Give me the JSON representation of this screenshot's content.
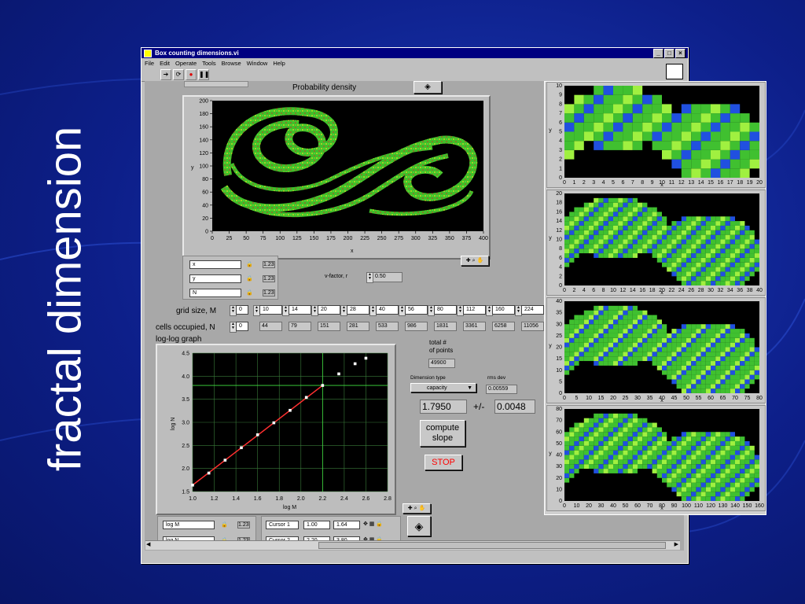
{
  "slide": {
    "title": "fractal dimension"
  },
  "window": {
    "title": "Box counting dimensions.vi",
    "controls": [
      "_",
      "□",
      "×"
    ]
  },
  "menu": [
    "File",
    "Edit",
    "Operate",
    "Tools",
    "Browse",
    "Window",
    "Help"
  ],
  "prob": {
    "label": "Probability density",
    "xlabel": "x",
    "ylabel": "y",
    "xticks": [
      "0",
      "25",
      "50",
      "75",
      "100",
      "125",
      "150",
      "175",
      "200",
      "225",
      "250",
      "275",
      "300",
      "325",
      "350",
      "375",
      "400"
    ],
    "yticks": [
      "0",
      "20",
      "40",
      "60",
      "80",
      "100",
      "120",
      "140",
      "160",
      "180",
      "200"
    ]
  },
  "legend1": [
    "x",
    "y",
    "N"
  ],
  "legend1_fmt": [
    "1.23",
    "1.23",
    "1.23"
  ],
  "vfactor": {
    "label": "v-factor, r",
    "value": "0.50"
  },
  "grid": {
    "label": "grid size, M",
    "first": "0",
    "values": [
      "10",
      "14",
      "20",
      "28",
      "40",
      "56",
      "80",
      "112",
      "160",
      "224"
    ]
  },
  "cells": {
    "label": "cells occupied, N",
    "first": "0",
    "values": [
      "44",
      "79",
      "151",
      "281",
      "533",
      "986",
      "1831",
      "3361",
      "6258",
      "11056"
    ]
  },
  "loglog": {
    "label": "log-log graph",
    "xlabel": "log M",
    "ylabel": "log N",
    "xticks": [
      "1.0",
      "1.2",
      "1.4",
      "1.6",
      "1.8",
      "2.0",
      "2.2",
      "2.4",
      "2.6",
      "2.8"
    ],
    "yticks": [
      "1.5",
      "2.0",
      "2.5",
      "3.0",
      "3.5",
      "4.0",
      "4.5"
    ]
  },
  "chart_data": {
    "type": "scatter",
    "x": [
      1.0,
      1.15,
      1.3,
      1.45,
      1.6,
      1.75,
      1.9,
      2.05,
      2.2,
      2.35,
      2.5,
      2.6
    ],
    "y": [
      1.64,
      1.9,
      2.18,
      2.45,
      2.73,
      2.99,
      3.26,
      3.54,
      3.8,
      4.05,
      4.27,
      4.39
    ],
    "fit": {
      "x": [
        1.0,
        2.2
      ],
      "y": [
        1.64,
        3.8
      ]
    },
    "xlabel": "log M",
    "ylabel": "log N",
    "xlim": [
      1.0,
      2.8
    ],
    "ylim": [
      1.5,
      4.5
    ],
    "cursors": [
      {
        "x": 2.2,
        "y": 3.8
      }
    ],
    "grid": true
  },
  "stats": {
    "total_label": "total #\nof points",
    "total": "49900",
    "dimtype_label": "Dimension type",
    "dimtype": "capacity",
    "rms_label": "rms dev",
    "rms": "0.00559",
    "dim": "1.7950",
    "pm": "+/-",
    "err": "0.0048"
  },
  "buttons": {
    "compute": "compute\nslope",
    "stop": "STOP"
  },
  "legend2": [
    "log M",
    "log N"
  ],
  "legend2_fmt": [
    "1.23",
    "1.23"
  ],
  "cursors": [
    {
      "name": "Cursor 1",
      "x": "1.00",
      "y": "1.64"
    },
    {
      "name": "Cursor 2",
      "x": "2.20",
      "y": "3.80"
    }
  ],
  "thumbs": [
    {
      "xticks": [
        "0",
        "1",
        "2",
        "3",
        "4",
        "5",
        "6",
        "7",
        "8",
        "9",
        "10",
        "11",
        "12",
        "13",
        "14",
        "15",
        "16",
        "17",
        "18",
        "19",
        "20"
      ],
      "yticks": [
        "0",
        "1",
        "2",
        "3",
        "4",
        "5",
        "6",
        "7",
        "8",
        "9",
        "10"
      ],
      "xlabel": "x",
      "ylabel": "y"
    },
    {
      "xticks": [
        "0",
        "2",
        "4",
        "6",
        "8",
        "10",
        "12",
        "14",
        "16",
        "18",
        "20",
        "22",
        "24",
        "26",
        "28",
        "30",
        "32",
        "34",
        "36",
        "38",
        "40"
      ],
      "yticks": [
        "0",
        "2",
        "4",
        "6",
        "8",
        "10",
        "12",
        "14",
        "16",
        "18",
        "20"
      ],
      "xlabel": "x",
      "ylabel": "y"
    },
    {
      "xticks": [
        "0",
        "5",
        "10",
        "15",
        "20",
        "25",
        "30",
        "35",
        "40",
        "45",
        "50",
        "55",
        "60",
        "65",
        "70",
        "75",
        "80"
      ],
      "yticks": [
        "0",
        "5",
        "10",
        "15",
        "20",
        "25",
        "30",
        "35",
        "40"
      ],
      "xlabel": "x",
      "ylabel": "y"
    },
    {
      "xticks": [
        "0",
        "10",
        "20",
        "30",
        "40",
        "50",
        "60",
        "70",
        "80",
        "90",
        "100",
        "110",
        "120",
        "130",
        "140",
        "150",
        "160"
      ],
      "yticks": [
        "0",
        "10",
        "20",
        "30",
        "40",
        "50",
        "60",
        "70",
        "80"
      ],
      "xlabel": "x",
      "ylabel": "y"
    }
  ],
  "colors": {
    "background": "#0d1f8a",
    "titlebar": "#000080",
    "panel": "#a8a8a8",
    "plot_bg": "#000000",
    "fit_line": "#ff3030",
    "grid": "#2e8b2e",
    "stop_text": "#ff0000"
  }
}
